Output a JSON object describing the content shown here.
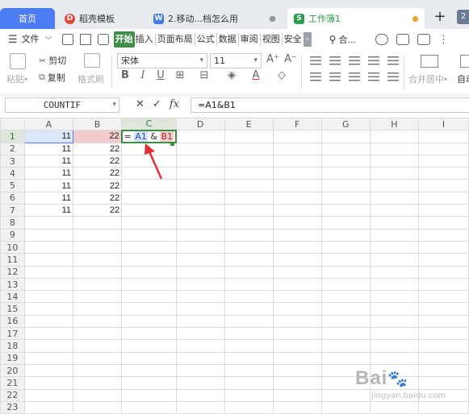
{
  "tabs": [
    {
      "label": "首页",
      "active": false
    },
    {
      "label": "稻壳模板",
      "badge": "D",
      "badge_color": "#e04a3a"
    },
    {
      "label": "2.移动...档怎么用",
      "badge": "W",
      "badge_color": "#3f7ce8"
    },
    {
      "label": "工作簿1",
      "badge": "S",
      "badge_color": "#2f9c4b",
      "active": true,
      "dot_color": "#f0a030"
    }
  ],
  "tab_add": "+",
  "tab_avatar": "2",
  "menu": {
    "file": "文件",
    "items": [
      "开始",
      "插入",
      "页面布局",
      "公式",
      "数据",
      "审阅",
      "视图",
      "安全"
    ],
    "active_index": 0,
    "search": "合..."
  },
  "ribbon": {
    "paste": "粘贴",
    "cut": "剪切",
    "copy": "复制",
    "format_painter": "格式刷",
    "font_name": "宋体",
    "font_size": "11",
    "merge": "合并居中",
    "wrap": "自动"
  },
  "formula_bar": {
    "name_box": "COUNTIF",
    "formula": "=A1&B1"
  },
  "sheet": {
    "columns": [
      "A",
      "B",
      "C",
      "D",
      "E",
      "F",
      "G",
      "H",
      "I"
    ],
    "rows": [
      "1",
      "2",
      "3",
      "4",
      "5",
      "6",
      "7",
      "8",
      "9",
      "10",
      "11",
      "12",
      "13",
      "14",
      "15",
      "16",
      "17",
      "18",
      "19",
      "20",
      "21",
      "22",
      "23"
    ],
    "data": [
      [
        "11",
        "22"
      ],
      [
        "11",
        "22"
      ],
      [
        "11",
        "22"
      ],
      [
        "11",
        "22"
      ],
      [
        "11",
        "22"
      ],
      [
        "11",
        "22"
      ],
      [
        "11",
        "22"
      ]
    ],
    "editing_cell": {
      "prefix": "= ",
      "ref_a": "A1",
      "amp": " & ",
      "ref_b": "B1"
    }
  },
  "colors": {
    "accent_green": "#3e8e41",
    "arrow_red": "#e03030",
    "home_tab_blue": "#4c7cf3"
  }
}
